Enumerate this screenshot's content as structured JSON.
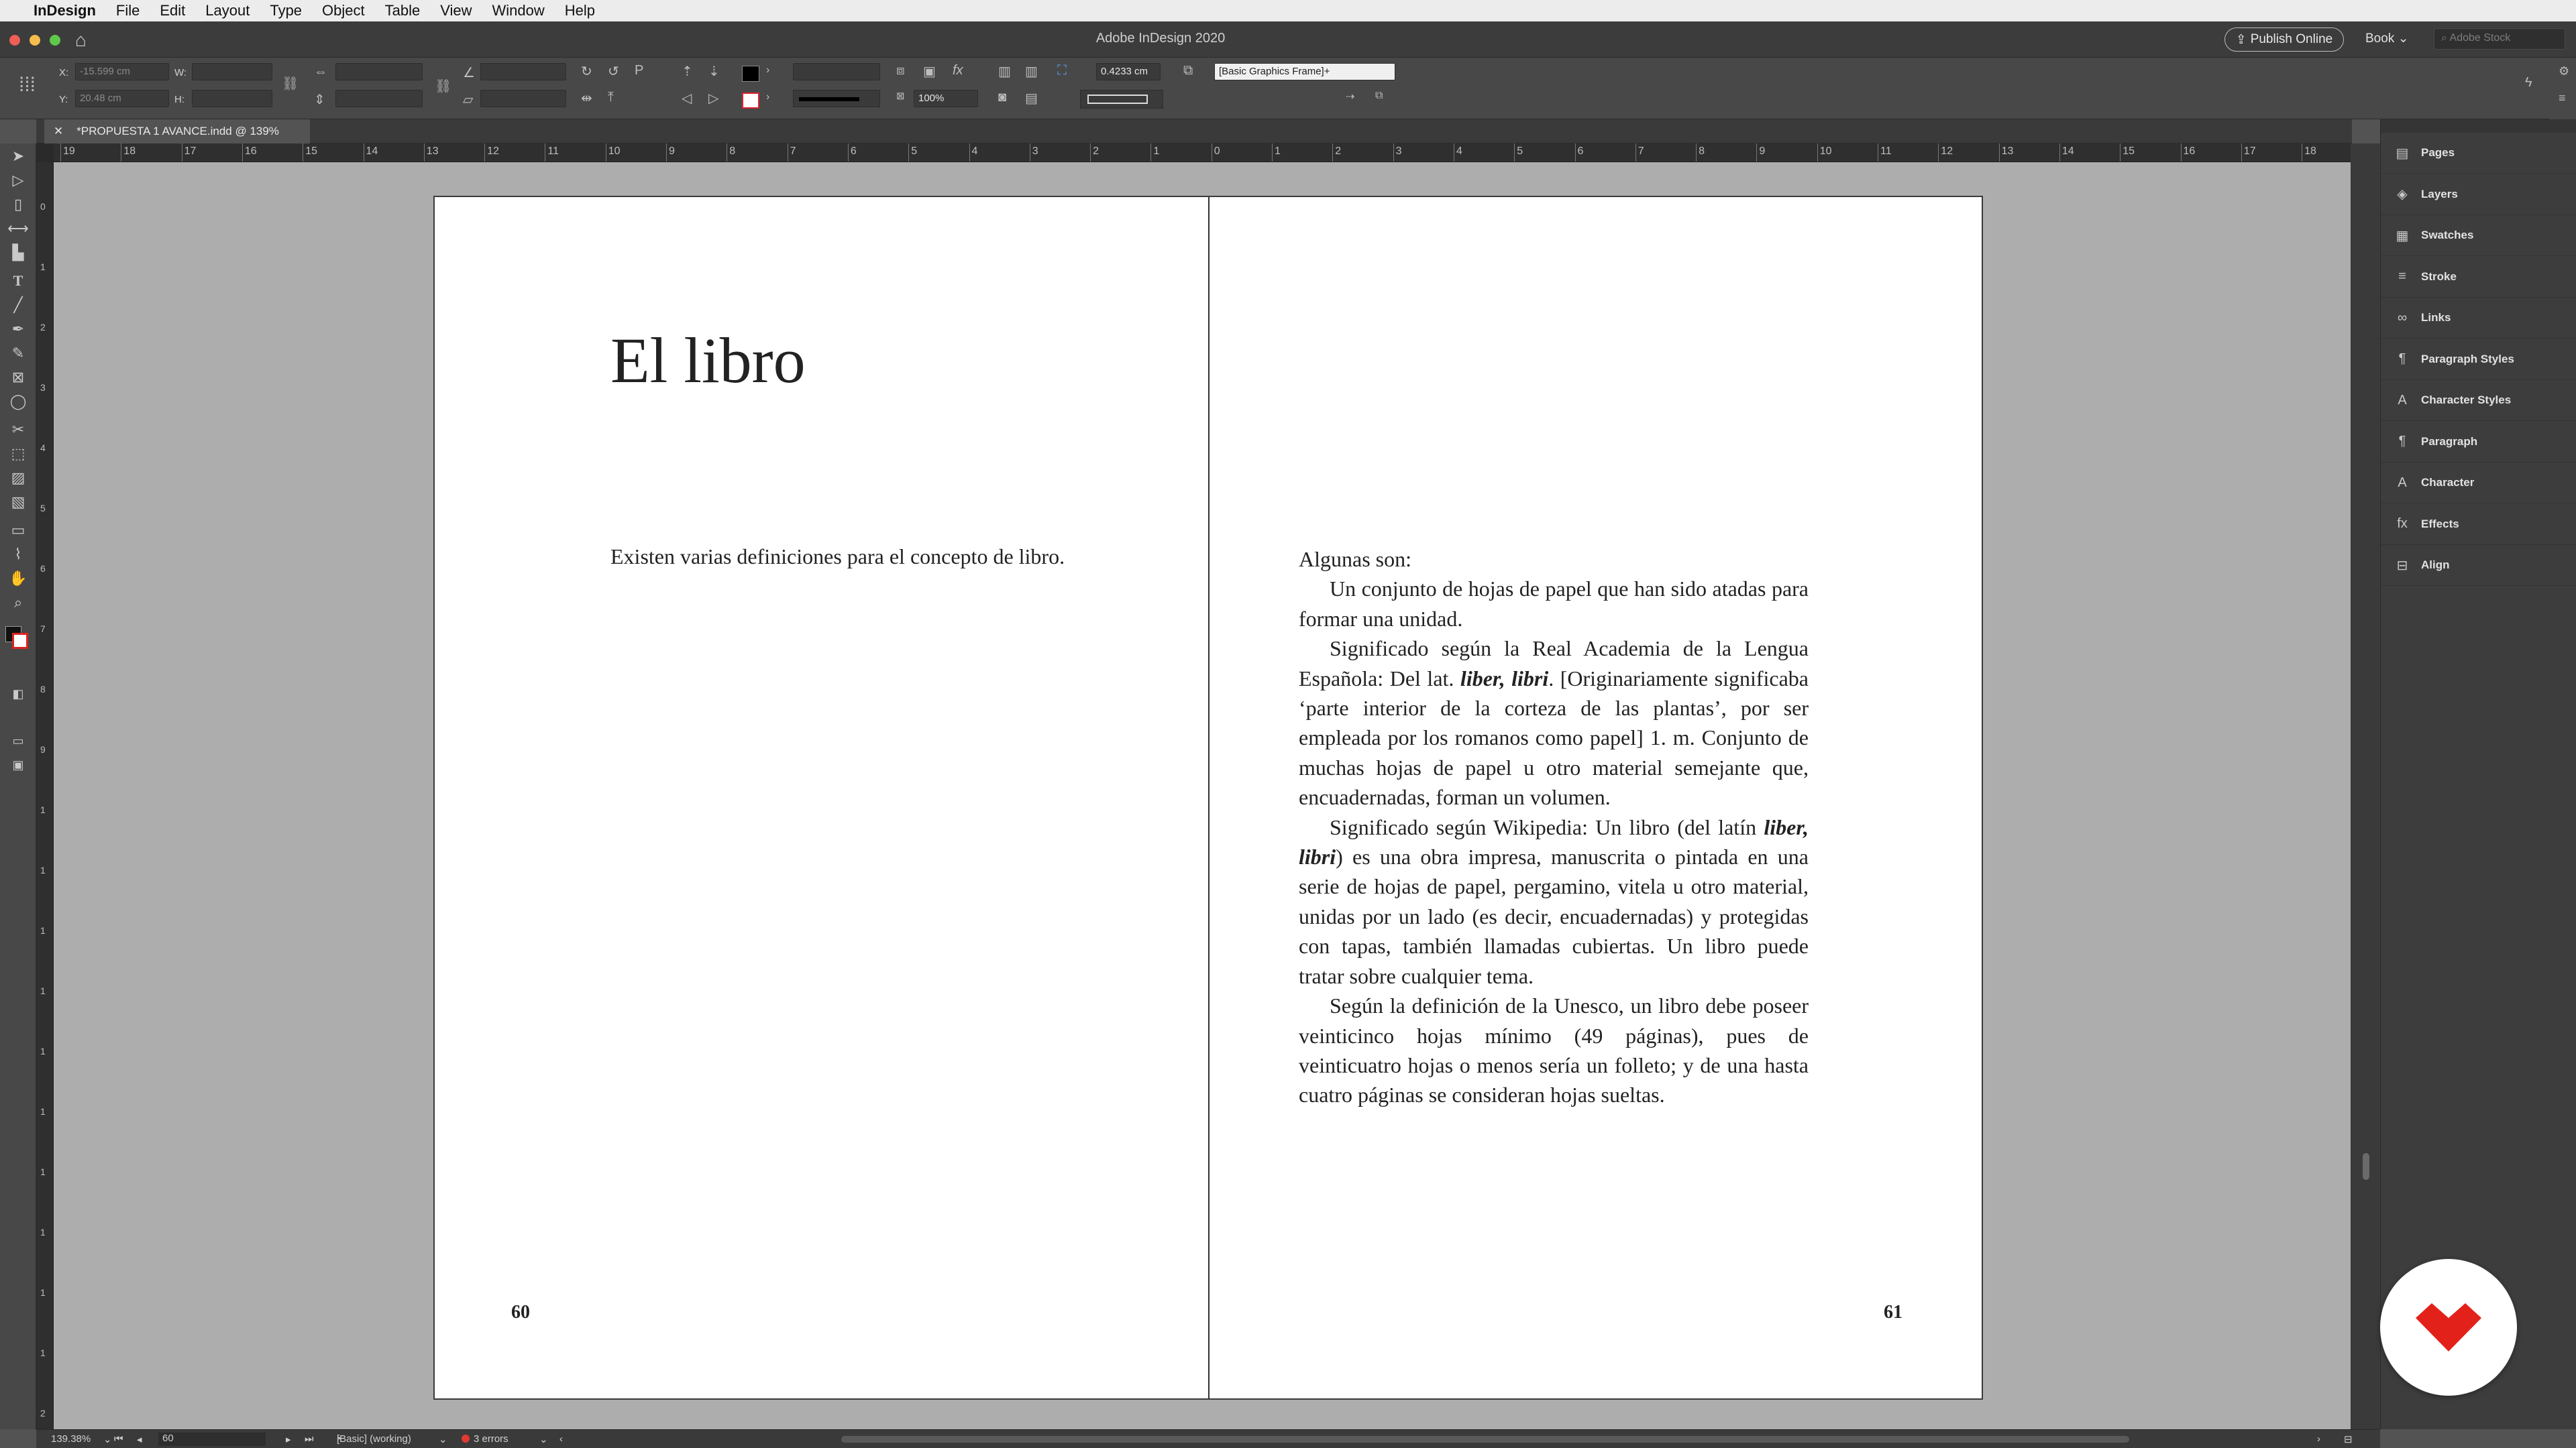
{
  "menubar": {
    "app": "InDesign",
    "items": [
      "File",
      "Edit",
      "Layout",
      "Type",
      "Object",
      "Table",
      "View",
      "Window",
      "Help"
    ]
  },
  "titlebar": {
    "title": "Adobe InDesign 2020",
    "publish_label": "Publish Online",
    "workspace": "Book",
    "stock_placeholder": "Adobe Stock"
  },
  "control": {
    "x_label": "X:",
    "x_value": "-15.599 cm",
    "y_label": "Y:",
    "y_value": "20.48 cm",
    "w_label": "W:",
    "h_label": "H:",
    "scale_percent": "100%",
    "stroke_weight": "0.4233 cm",
    "object_style": "[Basic Graphics Frame]+"
  },
  "tab": {
    "title": "*PROPUESTA 1 AVANCE.indd @ 139%"
  },
  "ruler": {
    "h_labels": [
      "19",
      "18",
      "17",
      "16",
      "15",
      "14",
      "13",
      "12",
      "11",
      "10",
      "9",
      "8",
      "7",
      "6",
      "5",
      "4",
      "3",
      "2",
      "1",
      "0",
      "1",
      "2",
      "3",
      "4",
      "5",
      "6",
      "7",
      "8",
      "9",
      "10",
      "11",
      "12",
      "13",
      "14",
      "15",
      "16",
      "17",
      "18"
    ],
    "v_labels": [
      "0",
      "1",
      "2",
      "3",
      "4",
      "5",
      "6",
      "7",
      "8",
      "9",
      "1",
      "1",
      "1",
      "1",
      "1",
      "1",
      "1",
      "1",
      "1",
      "1",
      "2"
    ]
  },
  "document": {
    "left_page": {
      "heading": "El libro",
      "intro": "Existen varias definiciones para el concepto de libro.",
      "page_number": "60"
    },
    "right_page": {
      "p1": "Algunas son:",
      "p2": "Un conjunto de hojas de papel que han sido atadas para formar una unidad.",
      "p3_a": "Significado según la Real Academia de la Lengua Española: Del lat. ",
      "p3_em": "liber, libri",
      "p3_b": ". [Originariamente significaba ‘parte interior de la corteza de las plantas’, por ser empleada por los romanos como papel] 1. m. Conjunto de muchas hojas de papel u otro material semejante que, encuadernadas, forman un volumen.",
      "p4_a": "Significado según Wikipedia: Un libro (del latín ",
      "p4_em": "liber, libri",
      "p4_b": ") es una obra impresa, manuscrita o pintada en una serie de hojas de papel, pergamino, vitela u otro material, unidas por un lado (es decir, encuadernadas) y protegidas con tapas, también llamadas cubiertas. Un libro puede tratar sobre cualquier tema.",
      "p5": "Según la definición de la Unesco, un libro debe poseer veinticinco hojas mínimo (49 páginas), pues de veinticuatro hojas o menos sería un folleto; y de una hasta cuatro páginas se consideran hojas sueltas.",
      "page_number": "61"
    }
  },
  "panels": [
    {
      "label": "Pages",
      "icon": "pages-icon",
      "glyph": "▤"
    },
    {
      "label": "Layers",
      "icon": "layers-icon",
      "glyph": "◈"
    },
    {
      "label": "Swatches",
      "icon": "swatches-icon",
      "glyph": "▦"
    },
    {
      "label": "Stroke",
      "icon": "stroke-icon",
      "glyph": "≡"
    },
    {
      "label": "Links",
      "icon": "links-icon",
      "glyph": "∞"
    },
    {
      "label": "Paragraph Styles",
      "icon": "paragraph-styles-icon",
      "glyph": "¶"
    },
    {
      "label": "Character Styles",
      "icon": "character-styles-icon",
      "glyph": "A"
    },
    {
      "label": "Paragraph",
      "icon": "paragraph-icon",
      "glyph": "¶"
    },
    {
      "label": "Character",
      "icon": "character-icon",
      "glyph": "A"
    },
    {
      "label": "Effects",
      "icon": "effects-icon",
      "glyph": "fx"
    },
    {
      "label": "Align",
      "icon": "align-icon",
      "glyph": "⊟"
    }
  ],
  "status": {
    "zoom": "139.38%",
    "page": "60",
    "preflight_profile": "[Basic] (working)",
    "errors": "3 errors"
  },
  "colors": {
    "error": "#e23a32",
    "logo_red": "#e3211b"
  }
}
